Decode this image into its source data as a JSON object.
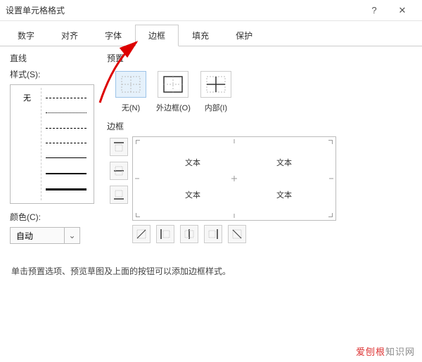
{
  "title": "设置单元格格式",
  "titlebar": {
    "help": "?",
    "close": "✕"
  },
  "tabs": [
    "数字",
    "对齐",
    "字体",
    "边框",
    "填充",
    "保护"
  ],
  "active_tab_index": 3,
  "left": {
    "line_label": "直线",
    "style_label": "样式(S):",
    "none_label": "无",
    "color_label": "颜色(C):",
    "color_value": "自动"
  },
  "right": {
    "preset_label": "预置",
    "presets": [
      {
        "label": "无(N)",
        "selected": true
      },
      {
        "label": "外边框(O)",
        "selected": false
      },
      {
        "label": "内部(I)",
        "selected": false
      }
    ],
    "border_label": "边框",
    "preview_text": "文本"
  },
  "hint": "单击预置选项、预览草图及上面的按钮可以添加边框样式。",
  "watermark": {
    "red": "爱刨根",
    "rest": "知识网"
  }
}
